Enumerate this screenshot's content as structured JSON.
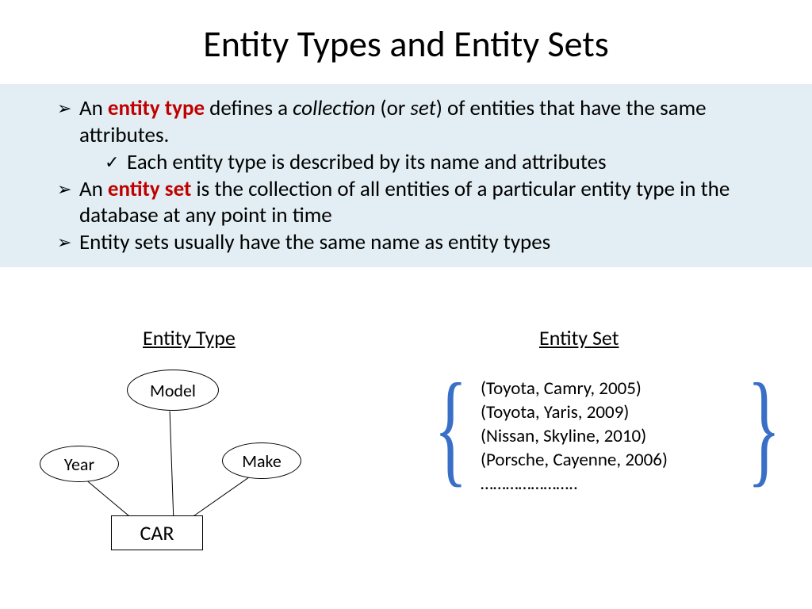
{
  "title": "Entity Types and Entity Sets",
  "bullets": {
    "b1a_pre": "An ",
    "b1a_kw": "entity type",
    "b1a_mid": " defines a ",
    "b1a_em": "collection",
    "b1a_post": " (or ",
    "b1a_em2": "set",
    "b1a_tail": ") of entities that have the same attributes.",
    "b1a_sub": "Each entity type is described by its name and attributes",
    "b2_pre": "An ",
    "b2_kw": "entity set",
    "b2_post": " is the collection of all entities of a particular entity type in the database at any point in time",
    "b3": "Entity sets usually have the same name as entity types"
  },
  "sub": {
    "et": "Entity Type",
    "es": "Entity Set"
  },
  "diagram": {
    "model": "Model",
    "year": "Year",
    "make": "Make",
    "car": "CAR"
  },
  "entityset": {
    "l1": "(Toyota, Camry, 2005)",
    "l2": "(Toyota, Yaris, 2009)",
    "l3": "(Nissan, Skyline, 2010)",
    "l4": "(Porsche, Cayenne, 2006)",
    "l5": "…………………..",
    "brace_left": "{",
    "brace_right": "}"
  }
}
